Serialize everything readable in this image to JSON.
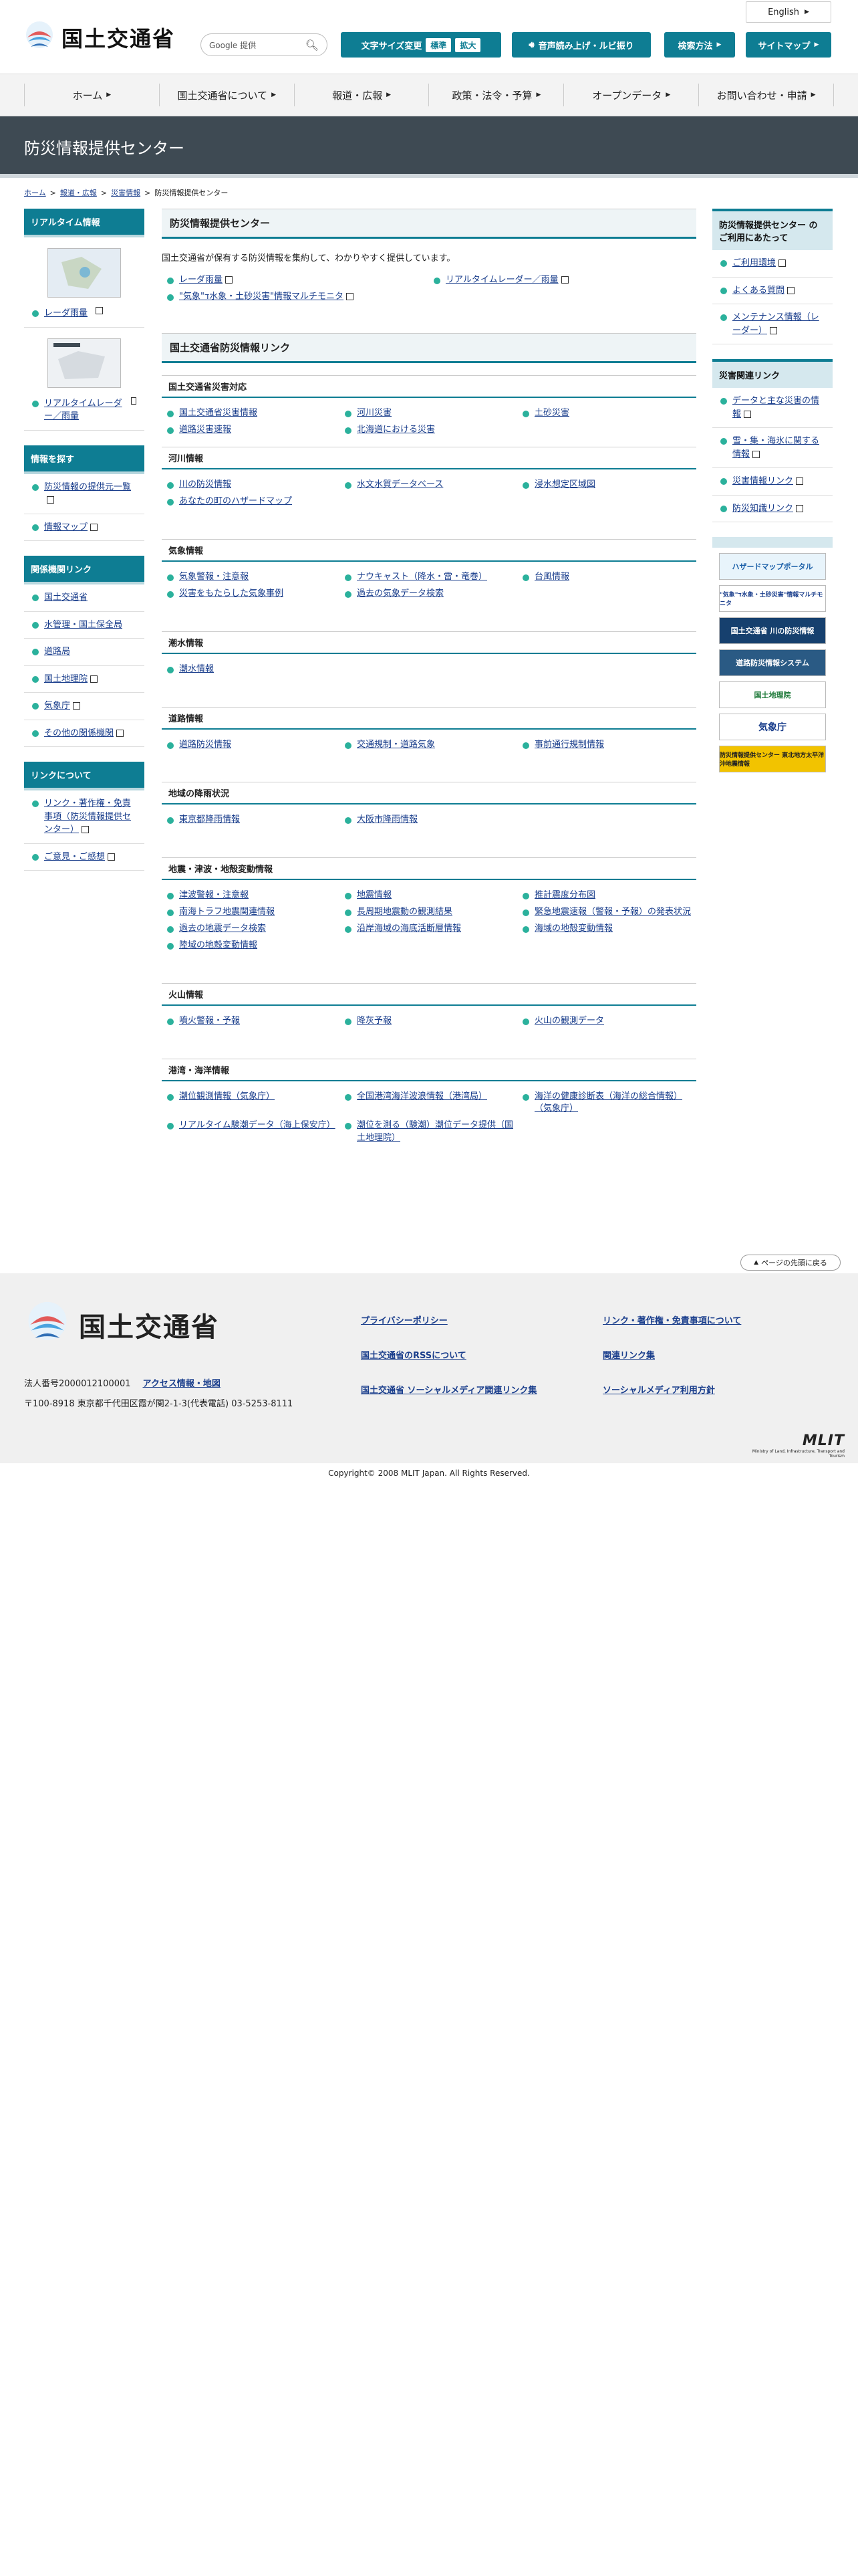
{
  "header": {
    "english": "English",
    "logo_text": "国土交通省",
    "search_label": "Google 提供",
    "font_size_label": "文字サイズ変更",
    "font_std": "標準",
    "font_large": "拡大",
    "voice_label": "音声読み上げ・ルビ振り",
    "search_method": "検索方法",
    "sitemap": "サイトマップ"
  },
  "gnav": [
    "ホーム",
    "国土交通省について",
    "報道・広報",
    "政策・法令・予算",
    "オープンデータ",
    "お問い合わせ・申請"
  ],
  "page_title": "防災情報提供センター",
  "breadcrumb": [
    "ホーム",
    "報道・広報",
    "災害情報",
    "防災情報提供センター"
  ],
  "left": {
    "realtime": {
      "title": "リアルタイム情報",
      "items": [
        "レーダ雨量",
        "リアルタイムレーダー／雨量"
      ]
    },
    "search": {
      "title": "情報を探す",
      "items": [
        "防災情報の提供元一覧",
        "情報マップ"
      ]
    },
    "related": {
      "title": "関係機関リンク",
      "items": [
        "国土交通省",
        "水管理・国土保全局",
        "道路局",
        "国土地理院",
        "気象庁",
        "その他の関係機関"
      ]
    },
    "links": {
      "title": "リンクについて",
      "items": [
        "リンク・著作権・免責事項（防災情報提供センター）",
        "ご意見・ご感想"
      ]
    }
  },
  "right": {
    "usage": {
      "title": "防災情報提供センター のご利用にあたって",
      "items": [
        "ご利用環境",
        "よくある質問",
        "メンテナンス情報（レーダー）"
      ]
    },
    "disaster": {
      "title": "災害関連リンク",
      "items": [
        "データと主な災害の情報",
        "雪・集・海氷に関する情報",
        "災害情報リンク",
        "防災知識リンク"
      ]
    },
    "banners": [
      "ハザードマップポータル",
      "\"気象\"ד水象・土砂災害\"情報マルチモニタ",
      "国土交通省 川の防災情報",
      "道路防災情報システム",
      "国土地理院",
      "気象庁",
      "防災情報提供センター 東北地方太平洋沖地震情報"
    ]
  },
  "main": {
    "title": "防災情報提供センター",
    "intro": "国土交通省が保有する防災情報を集約して、わかりやすく提供しています。",
    "top_links": [
      "レーダ雨量",
      "リアルタイムレーダー／雨量",
      "\"気象\"ד水象・土砂災害\"情報マルチモニタ"
    ],
    "link_title": "国土交通省防災情報リンク",
    "sections": [
      {
        "title": "国土交通省災害対応",
        "links": [
          "国土交通省災害情報",
          "河川災害",
          "土砂災害",
          "道路災害速報",
          "北海道における災害"
        ]
      },
      {
        "title": "河川情報",
        "links": [
          "川の防災情報",
          "水文水質データベース",
          "浸水想定区域図",
          "あなたの町のハザードマップ"
        ]
      },
      {
        "title": "気象情報",
        "links": [
          "気象警報・注意報",
          "ナウキャスト（降水・雷・竜巻）",
          "台風情報",
          "災害をもたらした気象事例",
          "過去の気象データ検索"
        ]
      },
      {
        "title": "潮水情報",
        "links": [
          "潮水情報"
        ]
      },
      {
        "title": "道路情報",
        "links": [
          "道路防災情報",
          "交通規制・道路気象",
          "事前通行規制情報"
        ]
      },
      {
        "title": "地域の降雨状況",
        "links": [
          "東京都降雨情報",
          "大阪市降雨情報"
        ]
      },
      {
        "title": "地震・津波・地殻変動情報",
        "links": [
          "津波警報・注意報",
          "地震情報",
          "推計震度分布図",
          "南海トラフ地震関連情報",
          "長周期地震動の観測結果",
          "緊急地震速報（警報・予報）の発表状況",
          "過去の地震データ検索",
          "沿岸海域の海底活断層情報",
          "海域の地殻変動情報",
          "陸域の地殻変動情報"
        ]
      },
      {
        "title": "火山情報",
        "links": [
          "噴火警報・予報",
          "降灰予報",
          "火山の観測データ"
        ]
      },
      {
        "title": "港湾・海洋情報",
        "links": [
          "潮位観測情報（気象庁）",
          "全国港湾海洋波浪情報（港湾局）",
          "海洋の健康診断表（海洋の総合情報）（気象庁）",
          "リアルタイム験潮データ（海上保安庁）",
          "潮位を測る（験潮）潮位データ提供（国土地理院）"
        ]
      }
    ]
  },
  "pagetop": "ページの先頭に戻る",
  "footer": {
    "logo_text": "国土交通省",
    "corp_no": "法人番号2000012100001",
    "access": "アクセス情報・地図",
    "address": "〒100-8918 東京都千代田区霞が関2-1-3(代表電話) 03-5253-8111",
    "links": [
      "プライバシーポリシー",
      "リンク・著作権・免責事項について",
      "国土交通省のRSSについて",
      "関連リンク集",
      "国土交通省 ソーシャルメディア関連リンク集",
      "ソーシャルメディア利用方針"
    ],
    "mlit": "MLIT",
    "mlit_sub": "Ministry of Land, Infrastructure, Transport and Tourism",
    "copyright": "Copyright© 2008 MLIT Japan. All Rights Reserved."
  },
  "colors": {
    "accent": "#0e7d93",
    "banner": "#3e4a53",
    "link": "#1a3e8c",
    "bullet": "#2bb19c"
  }
}
